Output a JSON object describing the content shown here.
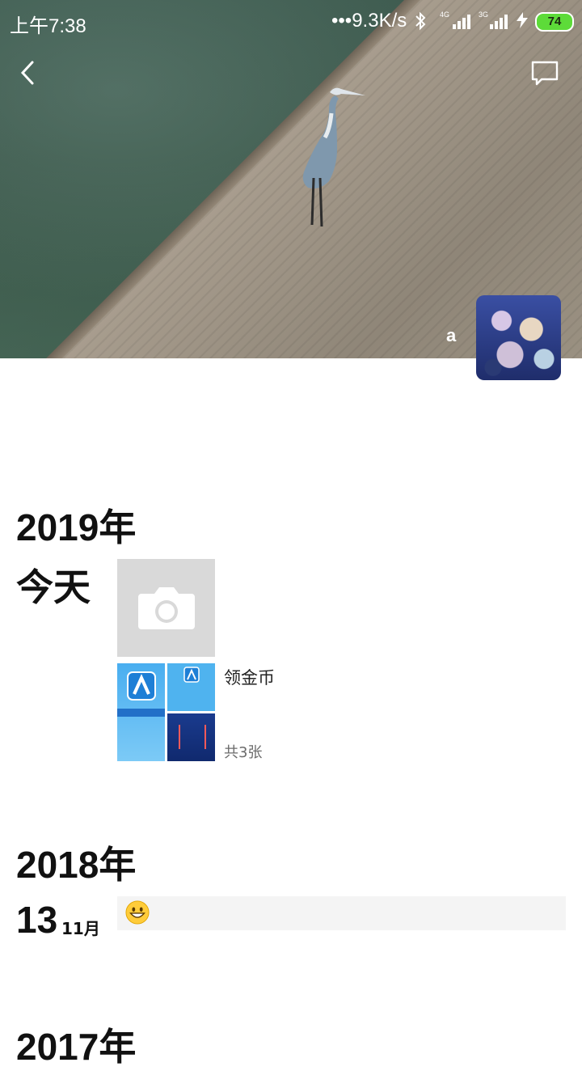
{
  "status_bar": {
    "time": "上午7:38",
    "net_speed": "•••9.3K/s",
    "signal_labels": "4G 3G",
    "battery": "74"
  },
  "header": {
    "back_icon": "chevron-left-icon",
    "comment_icon": "comment-icon"
  },
  "profile": {
    "nickname": "a"
  },
  "timeline": [
    {
      "year": "2019年",
      "day_label": "今天",
      "album": {
        "title": "领金币",
        "count": "共3张"
      }
    },
    {
      "year": "2018年",
      "day": "13",
      "month": "11月",
      "emoji": "grinning-face"
    },
    {
      "year": "2017年"
    }
  ],
  "colors": {
    "camera_tile": "#d9d9d9",
    "post_bar": "#f4f4f4",
    "battery_fill": "#5ddb39"
  }
}
